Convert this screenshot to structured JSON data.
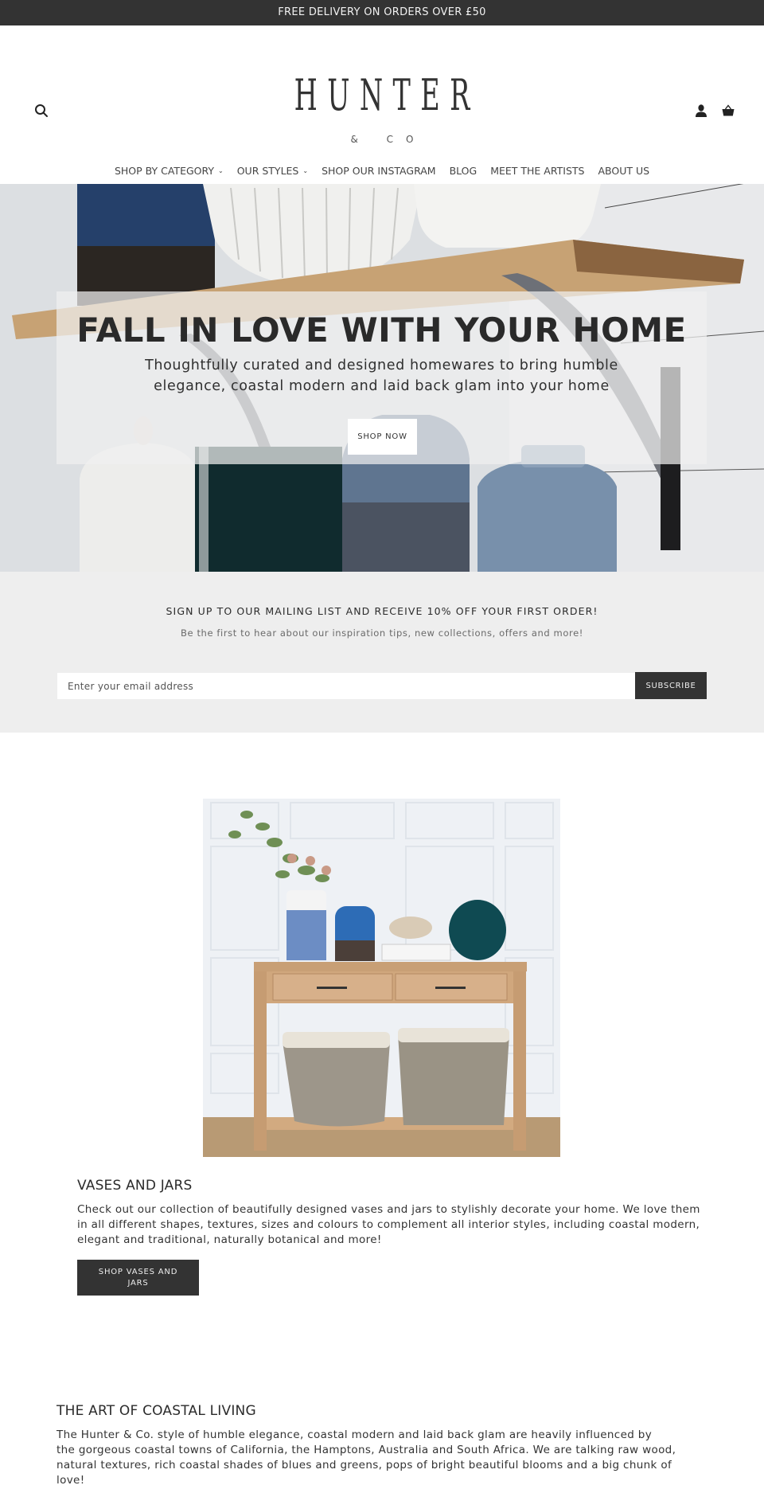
{
  "announcement": "FREE DELIVERY ON ORDERS OVER £50",
  "header": {
    "logo_main": "HUNTER",
    "logo_sub": "& CO",
    "icons": {
      "search": "search-icon",
      "account": "user-icon",
      "cart": "basket-icon"
    }
  },
  "nav": [
    {
      "label": "SHOP BY CATEGORY",
      "has_dropdown": true
    },
    {
      "label": "OUR STYLES",
      "has_dropdown": true
    },
    {
      "label": "SHOP OUR INSTAGRAM",
      "has_dropdown": false
    },
    {
      "label": "BLOG",
      "has_dropdown": false
    },
    {
      "label": "MEET THE ARTISTS",
      "has_dropdown": false
    },
    {
      "label": "ABOUT US",
      "has_dropdown": false
    }
  ],
  "nav_chevron": "⌄",
  "hero": {
    "title": "FALL IN LOVE WITH YOUR HOME",
    "subtitle": "Thoughtfully curated and designed homewares to bring humble elegance, coastal modern and laid back glam into your home",
    "button_label": "SHOP NOW"
  },
  "signup": {
    "title": "SIGN UP TO OUR MAILING LIST AND RECEIVE 10% OFF YOUR FIRST ORDER!",
    "subtitle": "Be the first to hear about our inspiration tips, new collections, offers and more!",
    "email_placeholder": "Enter your email address",
    "email_value": "",
    "button_label": "SUBSCRIBE"
  },
  "feature": {
    "image_alt": "Wooden console table with vases, jars and wicker baskets",
    "title": "VASES AND JARS",
    "body": "Check out our collection of beautifully designed vases and jars to stylishly decorate your home. We love them in all different shapes, textures, sizes and colours to complement all interior styles, including coastal modern, elegant and traditional, naturally botanical and more!",
    "button_label": "SHOP VASES AND JARS"
  },
  "about": {
    "title": "THE ART OF COASTAL LIVING",
    "body_lines": [
      "The Hunter & Co. style of humble elegance, coastal modern and laid back glam are heavily influenced by",
      "the gorgeous coastal towns of California, the Hamptons, Australia and South Africa. We are talking raw wood,",
      "natural textures, rich coastal shades of blues and greens, pops of bright beautiful blooms and a big chunk of",
      "love!"
    ]
  },
  "colors": {
    "dark": "#333333",
    "signup_bg": "#eeeeee",
    "text": "#333333"
  }
}
